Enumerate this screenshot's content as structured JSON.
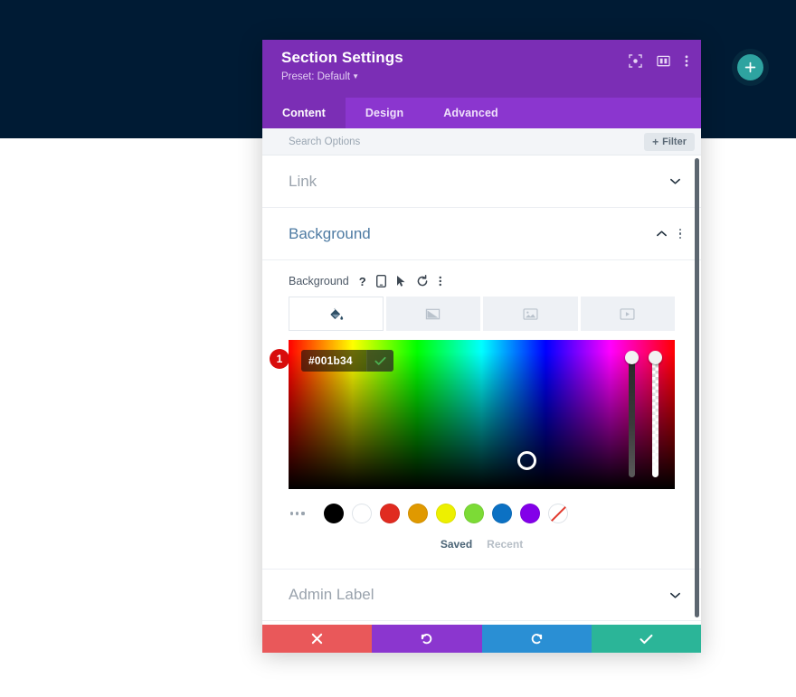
{
  "page": {
    "hero_background_color": "#001b34",
    "add_section_button": {
      "icon": "plus-icon",
      "color": "#2ea3a0"
    }
  },
  "modal": {
    "title": "Section Settings",
    "preset_label": "Preset: Default",
    "header_icons": [
      {
        "name": "focus-target-icon"
      },
      {
        "name": "split-view-icon"
      },
      {
        "name": "more-options-icon"
      }
    ],
    "tabs": [
      {
        "label": "Content",
        "active": true
      },
      {
        "label": "Design",
        "active": false
      },
      {
        "label": "Advanced",
        "active": false
      }
    ],
    "search": {
      "placeholder": "Search Options",
      "value": ""
    },
    "filter_button": {
      "label": "Filter",
      "plus": "+"
    },
    "sections": [
      {
        "label": "Link",
        "open": false
      },
      {
        "label": "Background",
        "open": true
      },
      {
        "label": "Admin Label",
        "open": false
      }
    ],
    "background": {
      "control_label": "Background",
      "control_icons": [
        {
          "name": "help-icon",
          "glyph": "?"
        },
        {
          "name": "responsive-device-icon"
        },
        {
          "name": "hover-cursor-icon"
        },
        {
          "name": "reset-icon"
        },
        {
          "name": "more-options-icon"
        }
      ],
      "type_tabs": [
        {
          "name": "background-color-tab",
          "active": true
        },
        {
          "name": "background-gradient-tab",
          "active": false
        },
        {
          "name": "background-image-tab",
          "active": false
        },
        {
          "name": "background-video-tab",
          "active": false
        }
      ],
      "hex_value": "#001b34",
      "confirm_icon": "check-icon",
      "step_badge": "1",
      "swatches": [
        {
          "name": "swatch-black",
          "color": "#000000"
        },
        {
          "name": "swatch-white",
          "color": "#ffffff"
        },
        {
          "name": "swatch-red",
          "color": "#e02b20"
        },
        {
          "name": "swatch-orange",
          "color": "#e09900"
        },
        {
          "name": "swatch-yellow",
          "color": "#edf000"
        },
        {
          "name": "swatch-green",
          "color": "#7cdb36"
        },
        {
          "name": "swatch-blue",
          "color": "#0c71c3"
        },
        {
          "name": "swatch-purple",
          "color": "#8300e9"
        },
        {
          "name": "swatch-transparent",
          "color": "transparent"
        }
      ],
      "palette_tabs": [
        {
          "label": "Saved",
          "active": true
        },
        {
          "label": "Recent",
          "active": false
        }
      ]
    },
    "footer_buttons": [
      {
        "name": "cancel-button",
        "icon": "close-icon",
        "color": "#e9585a"
      },
      {
        "name": "undo-button",
        "icon": "undo-icon",
        "color": "#8b36cf"
      },
      {
        "name": "redo-button",
        "icon": "redo-icon",
        "color": "#2a8fd4"
      },
      {
        "name": "save-button",
        "icon": "check-icon",
        "color": "#2bb598"
      }
    ]
  }
}
